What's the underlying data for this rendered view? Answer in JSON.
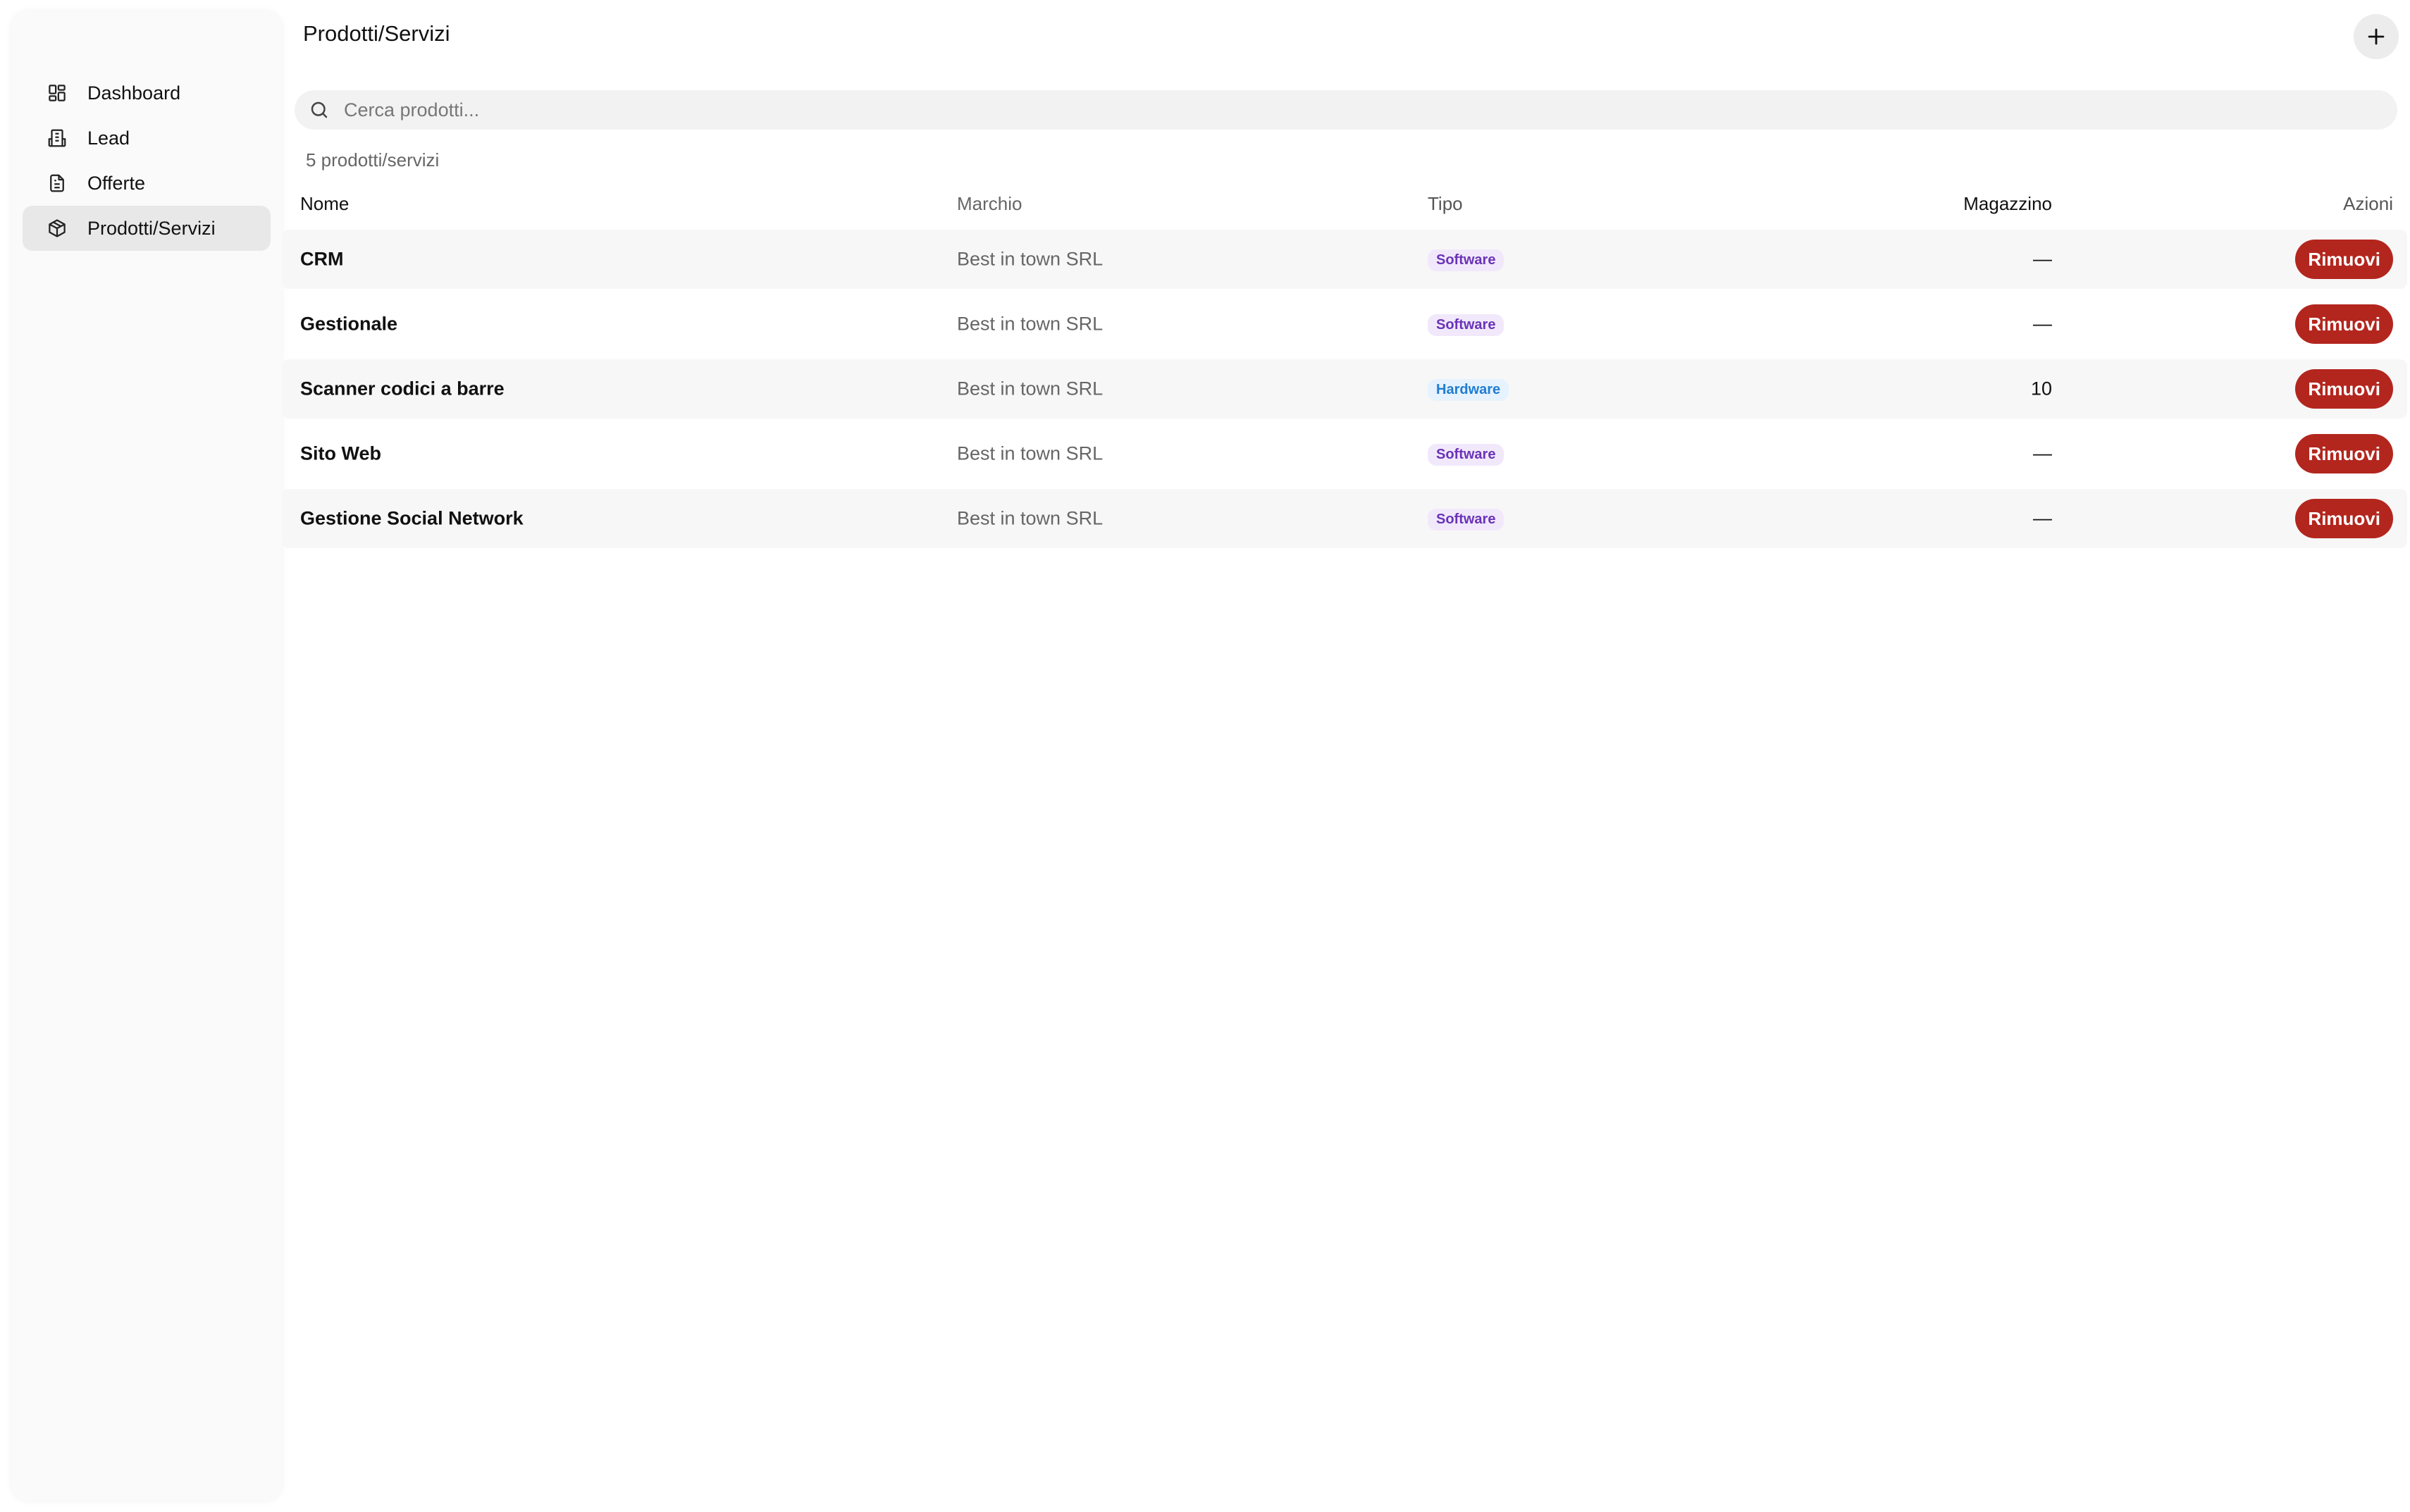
{
  "sidebar": {
    "items": [
      {
        "label": "Dashboard",
        "icon": "dashboard-icon",
        "active": false
      },
      {
        "label": "Lead",
        "icon": "building-icon",
        "active": false
      },
      {
        "label": "Offerte",
        "icon": "document-icon",
        "active": false
      },
      {
        "label": "Prodotti/Servizi",
        "icon": "package-icon",
        "active": true
      }
    ]
  },
  "header": {
    "title": "Prodotti/Servizi",
    "add_icon": "plus-icon"
  },
  "search": {
    "placeholder": "Cerca prodotti...",
    "value": ""
  },
  "list": {
    "count_label": "5 prodotti/servizi",
    "columns": {
      "name": "Nome",
      "brand": "Marchio",
      "type": "Tipo",
      "stock": "Magazzino",
      "actions": "Azioni"
    },
    "rows": [
      {
        "name": "CRM",
        "brand": "Best in town SRL",
        "type": "Software",
        "stock": "—",
        "action": "Rimuovi"
      },
      {
        "name": "Gestionale",
        "brand": "Best in town SRL",
        "type": "Software",
        "stock": "—",
        "action": "Rimuovi"
      },
      {
        "name": "Scanner codici a barre",
        "brand": "Best in town SRL",
        "type": "Hardware",
        "stock": "10",
        "action": "Rimuovi"
      },
      {
        "name": "Sito Web",
        "brand": "Best in town SRL",
        "type": "Software",
        "stock": "—",
        "action": "Rimuovi"
      },
      {
        "name": "Gestione Social Network",
        "brand": "Best in town SRL",
        "type": "Software",
        "stock": "—",
        "action": "Rimuovi"
      }
    ]
  },
  "colors": {
    "danger": "#b3261e",
    "software_badge_text": "#6a33b8",
    "hardware_badge_text": "#1f7dd1",
    "active_nav_bg": "#e8e8e8"
  }
}
